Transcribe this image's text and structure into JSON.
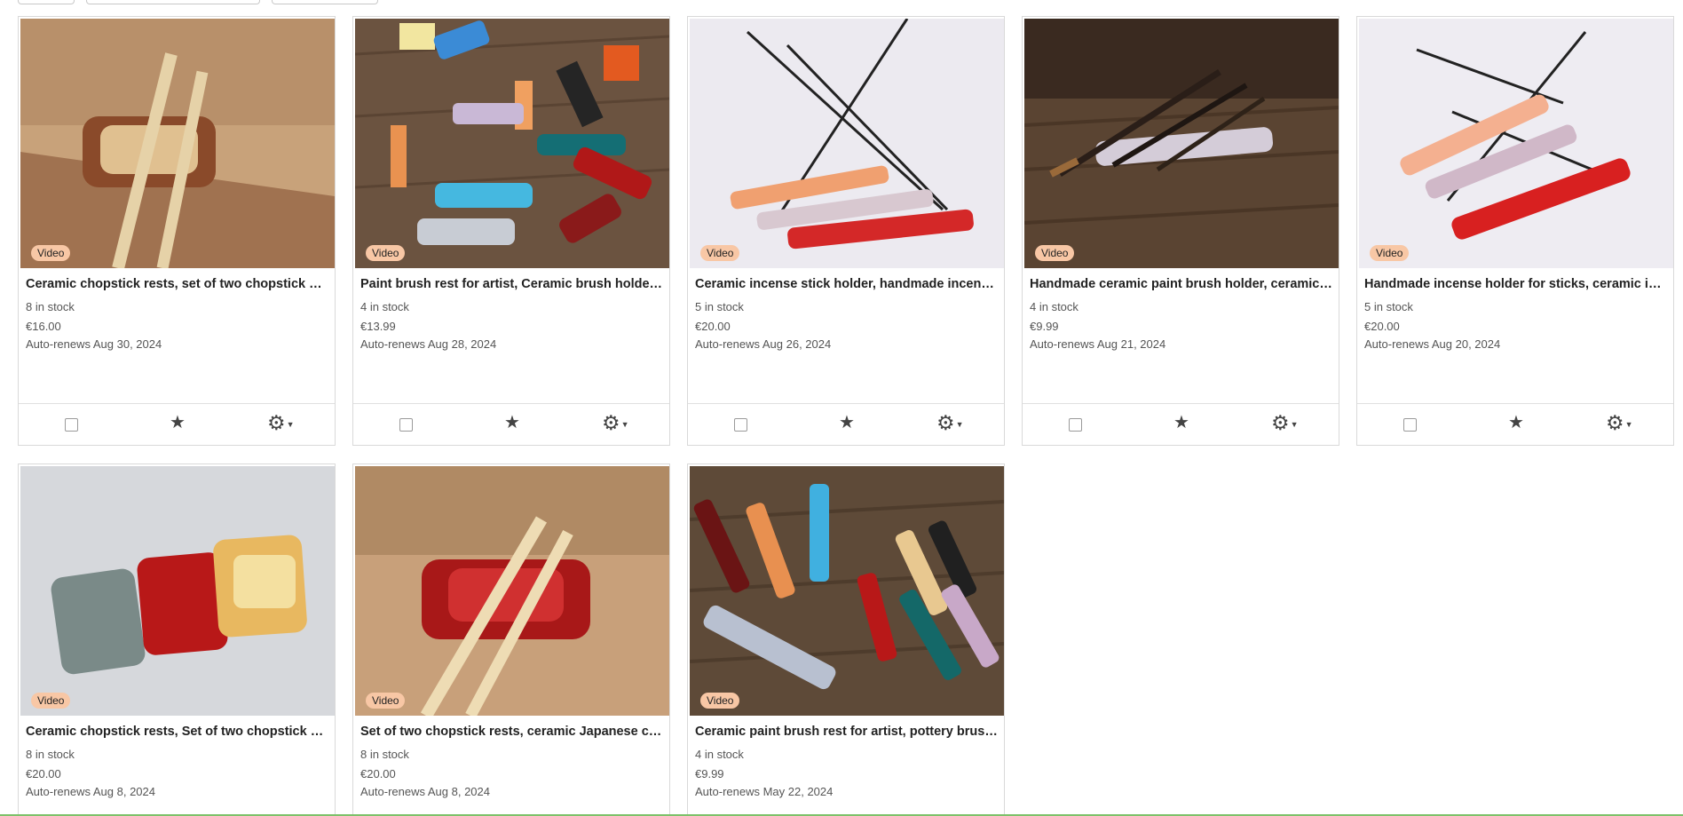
{
  "listings": [
    {
      "title": "Ceramic chopstick rests, set of two chopstick holders",
      "stock": "8 in stock",
      "price": "€16.00",
      "renew": "Auto-renews Aug 30, 2024",
      "badge": "Video",
      "image": "chopsticks-on-brown-ceramic-rest"
    },
    {
      "title": "Paint brush rest for artist, Ceramic brush holder, pottery",
      "stock": "4 in stock",
      "price": "€13.99",
      "renew": "Auto-renews Aug 28, 2024",
      "badge": "Video",
      "image": "colorful-brush-rests-with-paint-tubes"
    },
    {
      "title": "Ceramic incense stick holder, handmade incense burner",
      "stock": "5 in stock",
      "price": "€20.00",
      "renew": "Auto-renews Aug 26, 2024",
      "badge": "Video",
      "image": "three-incense-holders-with-sticks"
    },
    {
      "title": "Handmade ceramic paint brush holder, ceramic brush rest",
      "stock": "4 in stock",
      "price": "€9.99",
      "renew": "Auto-renews Aug 21, 2024",
      "badge": "Video",
      "image": "brushes-on-ceramic-rest-wood"
    },
    {
      "title": "Handmade incense holder for sticks, ceramic incense burner",
      "stock": "5 in stock",
      "price": "€20.00",
      "renew": "Auto-renews Aug 20, 2024",
      "badge": "Video",
      "image": "incense-holders-pink-red"
    },
    {
      "title": "Ceramic chopstick rests, Set of two chopstick holders",
      "stock": "8 in stock",
      "price": "€20.00",
      "renew": "Auto-renews Aug 8, 2024",
      "badge": "Video",
      "image": "three-chopstick-rests-grey-red-yellow"
    },
    {
      "title": "Set of two chopstick rests, ceramic Japanese chopstick holder",
      "stock": "8 in stock",
      "price": "€20.00",
      "renew": "Auto-renews Aug 8, 2024",
      "badge": "Video",
      "image": "chopsticks-on-red-ceramic-rest"
    },
    {
      "title": "Ceramic paint brush rest for artist, pottery brush holder",
      "stock": "4 in stock",
      "price": "€9.99",
      "renew": "Auto-renews May 22, 2024",
      "badge": "Video",
      "image": "many-colorful-brush-rests-on-wood"
    }
  ],
  "icons": {
    "checkbox": "checkbox-icon",
    "star": "star-icon",
    "gear": "gear-icon",
    "caret": "caret-down-icon"
  },
  "colors": {
    "badge": "#f8c7a5",
    "border": "#d9d9d9",
    "bottom_bar": "#7dc16a"
  }
}
